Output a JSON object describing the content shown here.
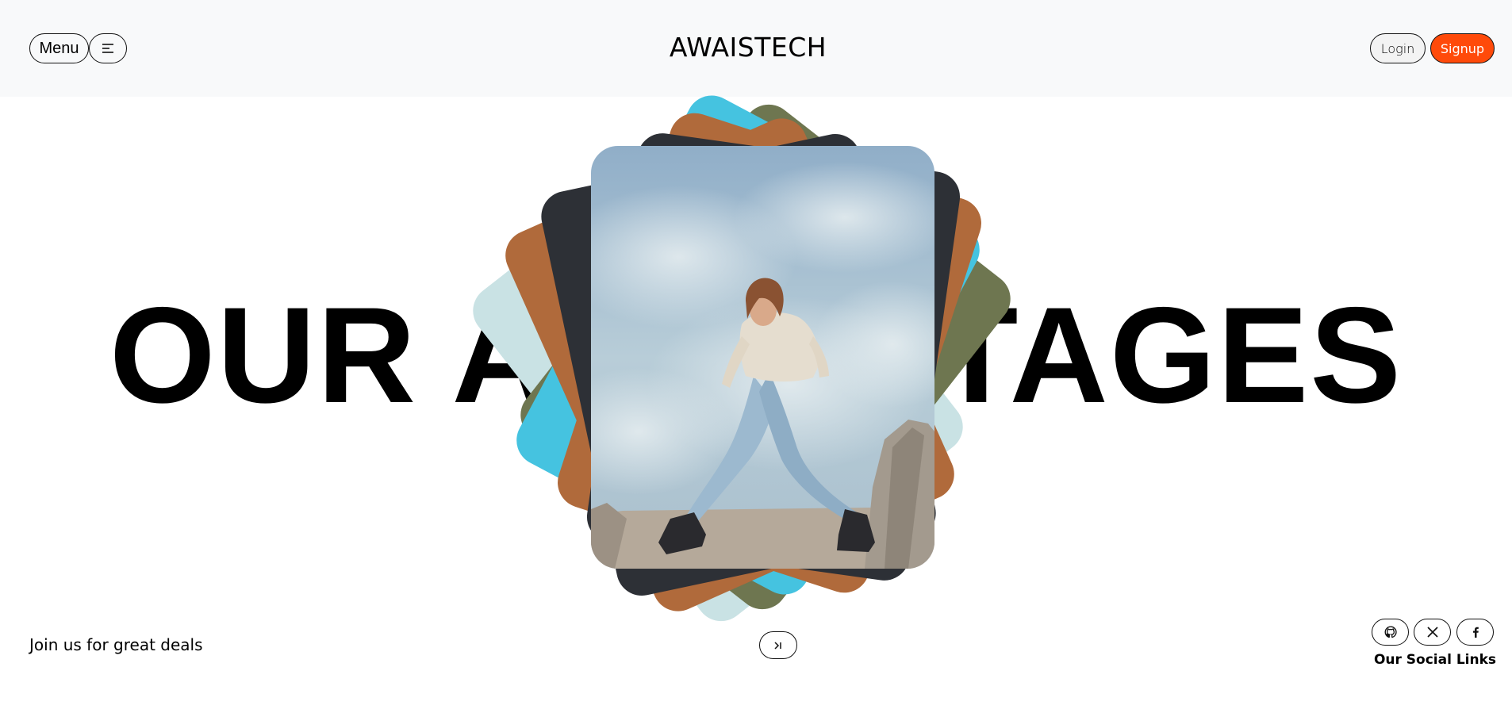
{
  "header": {
    "menu_label": "Menu",
    "menu_icon": "hamburger-icon",
    "brand": "AWAISTECH",
    "login_label": "Login",
    "signup_label": "Signup"
  },
  "hero": {
    "headline": "OUR ADVANTAGES"
  },
  "footer": {
    "tagline": "Join us for great deals",
    "next_icon": "skip-next-icon",
    "social_label": "Our Social Links",
    "social_icons": [
      "github-icon",
      "x-icon",
      "facebook-icon"
    ]
  },
  "colors": {
    "header_bg": "#f8f9fa",
    "signup_bg": "#ff4a0a",
    "card_cyan": "#45c3e0",
    "card_brown": "#b06a3b",
    "card_dark": "#2d3036",
    "card_olive": "#6e7650",
    "card_mint": "#c9e2e4"
  }
}
